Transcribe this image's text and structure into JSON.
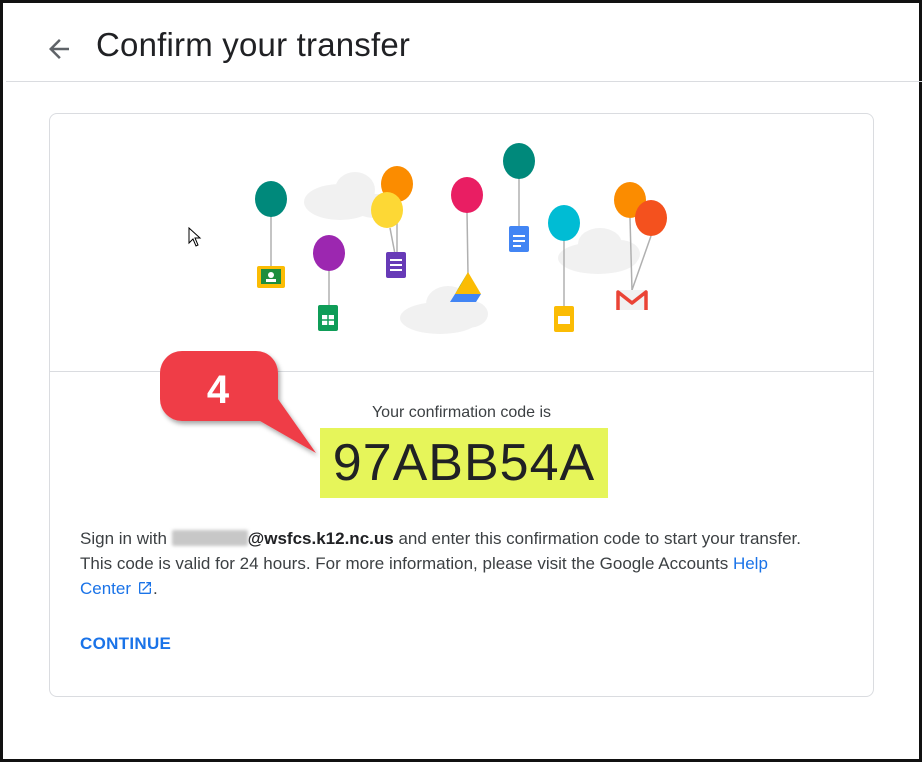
{
  "header": {
    "title": "Confirm your transfer",
    "back_icon": "arrow-left-icon"
  },
  "illustration": {
    "description_icons": [
      "balloon-icon",
      "cloud-icon",
      "google-classroom-icon",
      "google-sheets-icon",
      "google-forms-icon",
      "google-drive-icon",
      "google-docs-icon",
      "google-slides-icon",
      "gmail-icon"
    ]
  },
  "confirmation": {
    "label": "Your confirmation code is",
    "code": "97ABB54A",
    "highlight_color": "#e6f55a"
  },
  "description": {
    "sign_in_prefix": "Sign in with ",
    "email_domain": "@wsfcs.k12.nc.us",
    "line1_suffix": " and enter this confirmation code to start your transfer.",
    "line2": "This code is valid for 24 hours. For more information, please visit the Google Accounts ",
    "link_text_1": "Help",
    "link_text_2": "Center",
    "period": "."
  },
  "actions": {
    "continue_label": "CONTINUE"
  },
  "annotation": {
    "step_number": "4",
    "badge_color": "#ef3e47"
  },
  "colors": {
    "accent": "#1a73e8",
    "text": "#3c4043",
    "divider": "#dadce0"
  }
}
